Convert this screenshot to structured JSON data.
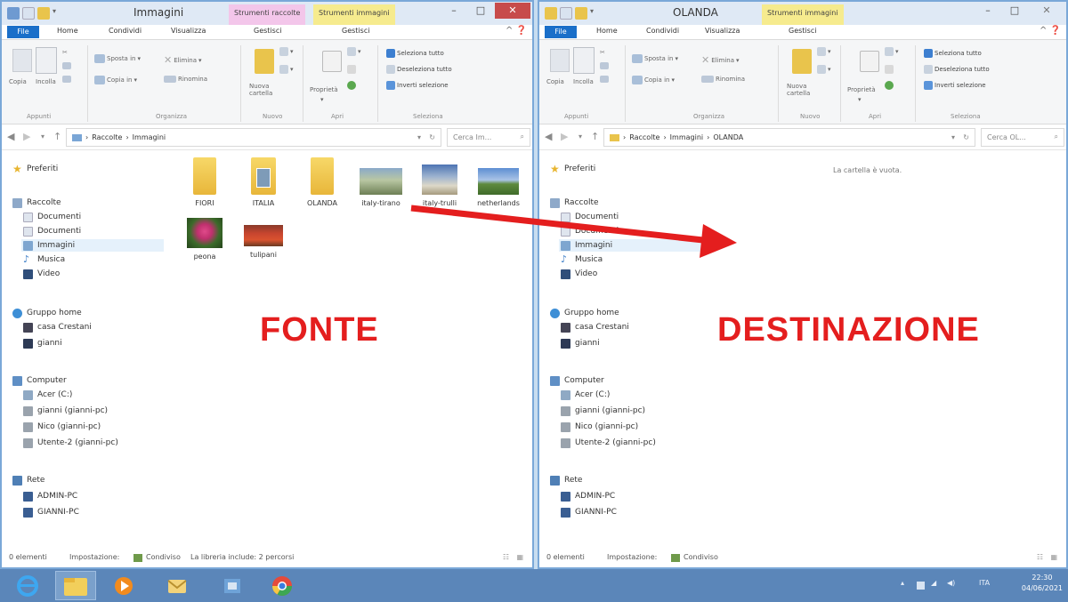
{
  "left_window": {
    "title": "Immagini",
    "ctx_tab_raccolte": "Strumenti raccolte",
    "ctx_tab_immagini": "Strumenti immagini",
    "tabs": [
      "File",
      "Home",
      "Condividi",
      "Visualizza",
      "Gestisci",
      "Gestisci"
    ],
    "ribbon": {
      "copia": "Copia",
      "incolla": "Incolla",
      "sposta_in": "Sposta in",
      "elimina": "Elimina",
      "copia_in": "Copia in",
      "rinomina": "Rinomina",
      "nuova_cartella_1": "Nuova",
      "nuova_cartella_2": "cartella",
      "proprieta": "Proprietà",
      "seleziona_tutto": "Seleziona tutto",
      "deseleziona_tutto": "Deseleziona tutto",
      "inverti_selezione": "Inverti selezione",
      "groups": [
        "Appunti",
        "Organizza",
        "Nuovo",
        "Apri",
        "Seleziona"
      ]
    },
    "breadcrumb": [
      "Raccolte",
      "Immagini"
    ],
    "search_placeholder": "Cerca Im...",
    "files": [
      {
        "name": "FIORI",
        "kind": "folder"
      },
      {
        "name": "ITALIA",
        "kind": "folder-photo"
      },
      {
        "name": "OLANDA",
        "kind": "folder"
      },
      {
        "name": "italy-tirano",
        "kind": "photo"
      },
      {
        "name": "italy-trulli",
        "kind": "photo"
      },
      {
        "name": "netherlands",
        "kind": "photo"
      },
      {
        "name": "peona",
        "kind": "photo"
      },
      {
        "name": "tulipani",
        "kind": "photo"
      }
    ],
    "status": {
      "count": "0 elementi",
      "impostazione_label": "Impostazione:",
      "impostazione_value": "Condiviso",
      "libreria": "La libreria include: 2 percorsi"
    }
  },
  "right_window": {
    "title": "OLANDA",
    "ctx_tab_immagini": "Strumenti immagini",
    "tabs": [
      "File",
      "Home",
      "Condividi",
      "Visualizza",
      "Gestisci"
    ],
    "breadcrumb": [
      "Raccolte",
      "Immagini",
      "OLANDA"
    ],
    "search_placeholder": "Cerca OL...",
    "empty_message": "La cartella è vuota.",
    "status": {
      "count": "0 elementi",
      "impostazione_label": "Impostazione:",
      "impostazione_value": "Condiviso"
    }
  },
  "nav": {
    "preferiti": "Preferiti",
    "raccolte": "Raccolte",
    "documenti_1": "Documenti",
    "documenti_2": "Documenti",
    "immagini": "Immagini",
    "musica": "Musica",
    "video": "Video",
    "gruppo_home": "Gruppo home",
    "casa_crestani": "casa Crestani",
    "gianni": "gianni",
    "computer": "Computer",
    "acer": "Acer (C:)",
    "gianni_pc": "gianni (gianni-pc)",
    "nico_pc": "Nico (gianni-pc)",
    "utente2_pc": "Utente-2 (gianni-pc)",
    "rete": "Rete",
    "admin_pc": "ADMIN-PC",
    "gianni_pc_net": "GIANNI-PC"
  },
  "labels": {
    "fonte": "FONTE",
    "destinazione": "DESTINAZIONE"
  },
  "taskbar": {
    "lang": "ITA",
    "time": "22:30",
    "date": "04/06/2021"
  },
  "colors": {
    "accent_blue": "#1a6fc9",
    "arrow_red": "#e41e1e",
    "ctx_pink": "#f3c6ea",
    "ctx_yellow": "#f6eb8e"
  }
}
